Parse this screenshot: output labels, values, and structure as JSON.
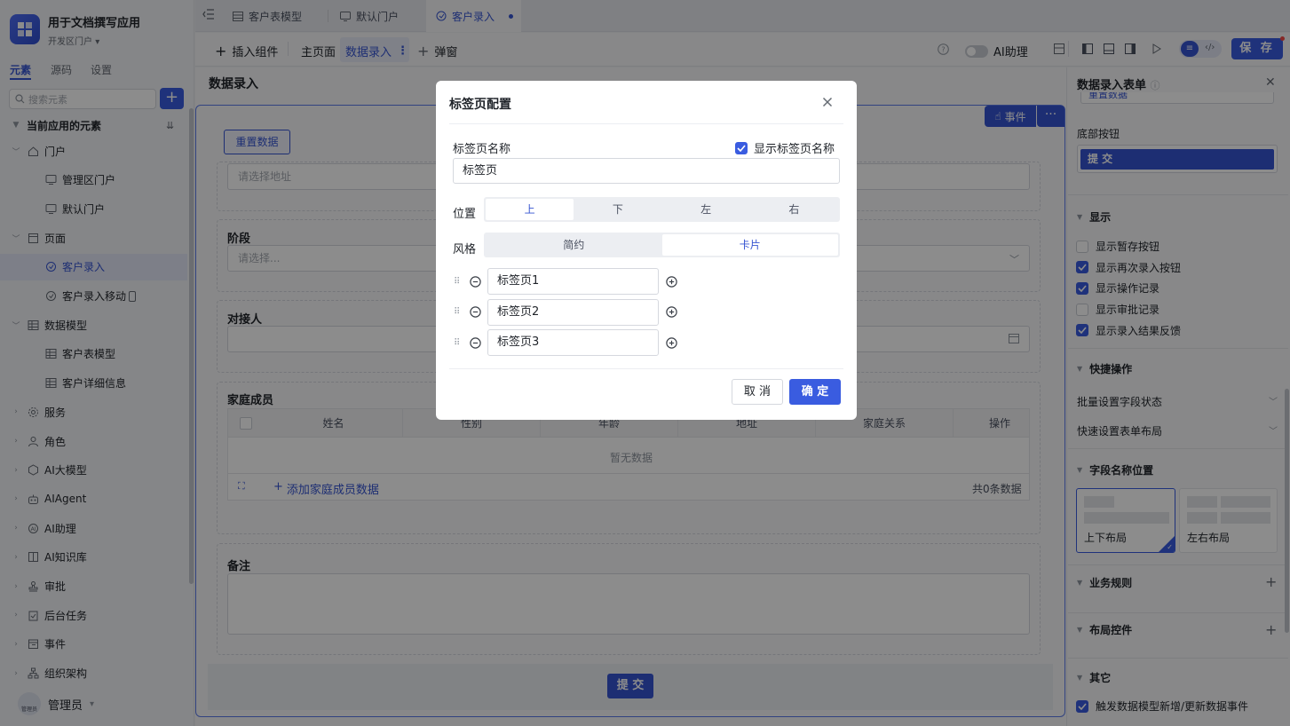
{
  "app": {
    "title": "用于文档撰写应用",
    "portal": "开发区门户"
  },
  "sidebar": {
    "tabs": [
      "元素",
      "源码",
      "设置"
    ],
    "search_placeholder": "搜索元素",
    "section_title": "当前应用的元素",
    "items": [
      {
        "label": "门户",
        "icon": "home-icon"
      },
      {
        "label": "管理区门户",
        "icon": "portal-icon"
      },
      {
        "label": "默认门户",
        "icon": "portal-icon"
      },
      {
        "label": "页面",
        "icon": "page-icon"
      },
      {
        "label": "客户录入",
        "icon": "form-page-icon"
      },
      {
        "label": "客户录入移动",
        "icon": "form-page-icon"
      },
      {
        "label": "数据模型",
        "icon": "table-icon"
      },
      {
        "label": "客户表模型",
        "icon": "table-icon"
      },
      {
        "label": "客户详细信息",
        "icon": "table-icon"
      },
      {
        "label": "服务",
        "icon": "service-icon"
      },
      {
        "label": "角色",
        "icon": "role-icon"
      },
      {
        "label": "AI大模型",
        "icon": "model-icon"
      },
      {
        "label": "AIAgent",
        "icon": "robot-icon"
      },
      {
        "label": "AI助理",
        "icon": "assistant-icon"
      },
      {
        "label": "AI知识库",
        "icon": "book-icon"
      },
      {
        "label": "审批",
        "icon": "stamp-icon"
      },
      {
        "label": "后台任务",
        "icon": "task-icon"
      },
      {
        "label": "事件",
        "icon": "event-icon"
      },
      {
        "label": "组织架构",
        "icon": "org-icon"
      }
    ],
    "user": {
      "name": "管理员",
      "avatar_text": "管理员"
    }
  },
  "tabs": [
    {
      "label": "客户表模型"
    },
    {
      "label": "默认门户"
    },
    {
      "label": "客户录入"
    }
  ],
  "toolbar": {
    "insert": "插入组件",
    "main_page": "主页面",
    "data_entry": "数据录入",
    "popup": "弹窗",
    "ai_assistant": "AI助理",
    "save": "保 存"
  },
  "canvas": {
    "page_title": "数据录入",
    "reset_button": "重置数据",
    "event_button": "事件",
    "address_placeholder": "请选择地址",
    "stage_label": "阶段",
    "stage_placeholder": "请选择...",
    "contact_label": "对接人",
    "family_label": "家庭成员",
    "family_columns": [
      "姓名",
      "性别",
      "年龄",
      "地址",
      "家庭关系",
      "操作"
    ],
    "empty_text": "暂无数据",
    "add_family": "添加家庭成员数据",
    "total_text": "共0条数据",
    "remark_label": "备注",
    "submit": "提 交"
  },
  "right_panel": {
    "title": "数据录入表单",
    "partial_button": "重置数据",
    "bottom_buttons_label": "底部按钮",
    "bottom_button": "提 交",
    "display_section": "显示",
    "display_options": [
      {
        "label": "显示暂存按钮",
        "checked": false
      },
      {
        "label": "显示再次录入按钮",
        "checked": true
      },
      {
        "label": "显示操作记录",
        "checked": true
      },
      {
        "label": "显示审批记录",
        "checked": false
      },
      {
        "label": "显示录入结果反馈",
        "checked": true
      }
    ],
    "quick_ops_section": "快捷操作",
    "quick_ops": [
      "批量设置字段状态",
      "快速设置表单布局"
    ],
    "field_name_pos_section": "字段名称位置",
    "layouts": [
      "上下布局",
      "左右布局"
    ],
    "business_rules": "业务规则",
    "layout_controls": "布局控件",
    "other_section": "其它",
    "other_option": "触发数据模型新增/更新数据事件"
  },
  "modal": {
    "title": "标签页配置",
    "name_label": "标签页名称",
    "show_name_label": "显示标签页名称",
    "name_value": "标签页",
    "position_label": "位置",
    "positions": [
      "上",
      "下",
      "左",
      "右"
    ],
    "position_selected": "上",
    "style_label": "风格",
    "styles": [
      "简约",
      "卡片"
    ],
    "style_selected": "卡片",
    "tab_items": [
      "标签页1",
      "标签页2",
      "标签页3"
    ],
    "cancel": "取 消",
    "ok": "确 定"
  },
  "colors": {
    "accent": "#3a5ce0",
    "overlay": "rgba(0,0,0,0.45)"
  }
}
